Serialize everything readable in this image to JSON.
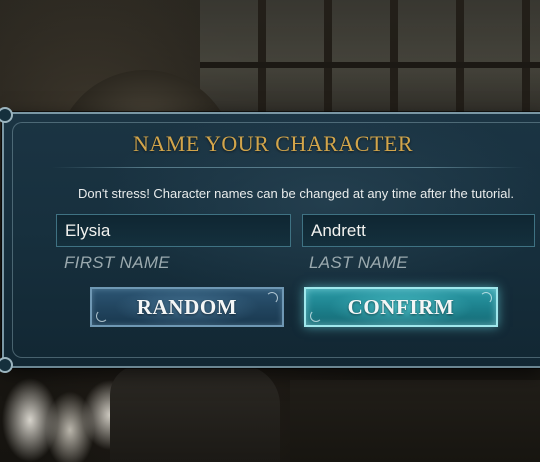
{
  "dialog": {
    "title": "NAME YOUR CHARACTER",
    "subtitle": "Don't stress! Character names can be changed at any time after the tutorial.",
    "first_name": {
      "value": "Elysia",
      "label": "FIRST NAME"
    },
    "last_name": {
      "value": "Andrett",
      "label": "LAST NAME"
    },
    "buttons": {
      "random": "RANDOM",
      "confirm": "CONFIRM"
    }
  },
  "colors": {
    "title_gold": "#d2a54b",
    "panel_teal": "#17303e",
    "confirm_accent": "#2a9aa6",
    "random_accent": "#2c5573"
  }
}
